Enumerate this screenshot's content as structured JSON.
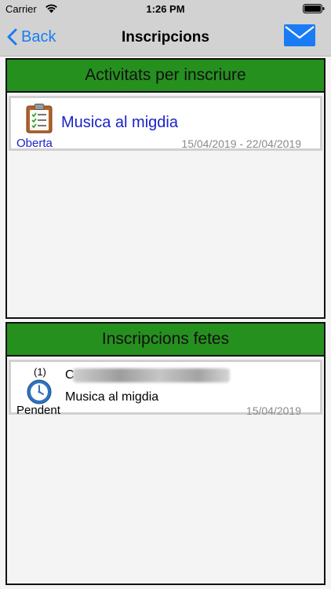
{
  "status_bar": {
    "carrier": "Carrier",
    "time": "1:26 PM",
    "wifi_icon": "wifi-icon",
    "battery_icon": "battery-icon"
  },
  "nav": {
    "back_label": "Back",
    "title": "Inscripcions",
    "mail_icon": "mail-icon"
  },
  "colors": {
    "accent": "#1a7cf5",
    "header_green": "#26901f",
    "link_blue": "#1a22c8",
    "date_gray": "#8a8a8a"
  },
  "sections": {
    "available": {
      "header": "Activitats per inscriure",
      "items": [
        {
          "icon": "clipboard-checklist-icon",
          "title": "Musica al migdia",
          "status": "Oberta",
          "dates": "15/04/2019 - 22/04/2019"
        }
      ]
    },
    "done": {
      "header": "Inscripcions fetes",
      "items": [
        {
          "icon": "clock-icon",
          "count": "(1)",
          "name_initial": "C",
          "activity": "Musica al migdia",
          "status": "Pendent",
          "date": "15/04/2019"
        }
      ]
    }
  }
}
